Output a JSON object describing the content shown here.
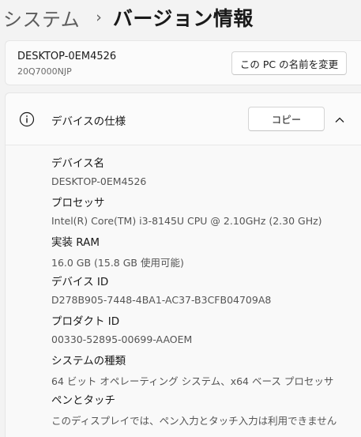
{
  "breadcrumb": {
    "parent": "システム",
    "separator": "›",
    "current": "バージョン情報"
  },
  "device": {
    "name": "DESKTOP-0EM4526",
    "model": "20Q7000NJP",
    "rename_button": "この PC の名前を変更"
  },
  "specs": {
    "title": "デバイスの仕様",
    "copy_button": "コピー",
    "icon": "info-icon",
    "expand_icon": "chevron-up-icon",
    "items": [
      {
        "label": "デバイス名",
        "value": "DESKTOP-0EM4526"
      },
      {
        "label": "プロセッサ",
        "value": "Intel(R) Core(TM) i3-8145U CPU @ 2.10GHz (2.30 GHz)"
      },
      {
        "label": "実装 RAM",
        "value": "16.0 GB (15.8 GB 使用可能)"
      },
      {
        "label": "デバイス ID",
        "value": "D278B905-7448-4BA1-AC37-B3CFB04709A8"
      },
      {
        "label": "プロダクト ID",
        "value": "00330-52895-00699-AAOEM"
      },
      {
        "label": "システムの種類",
        "value": "64 ビット オペレーティング システム、x64 ベース プロセッサ"
      },
      {
        "label": "ペンとタッチ",
        "value": "このディスプレイでは、ペン入力とタッチ入力は利用できません"
      }
    ]
  }
}
